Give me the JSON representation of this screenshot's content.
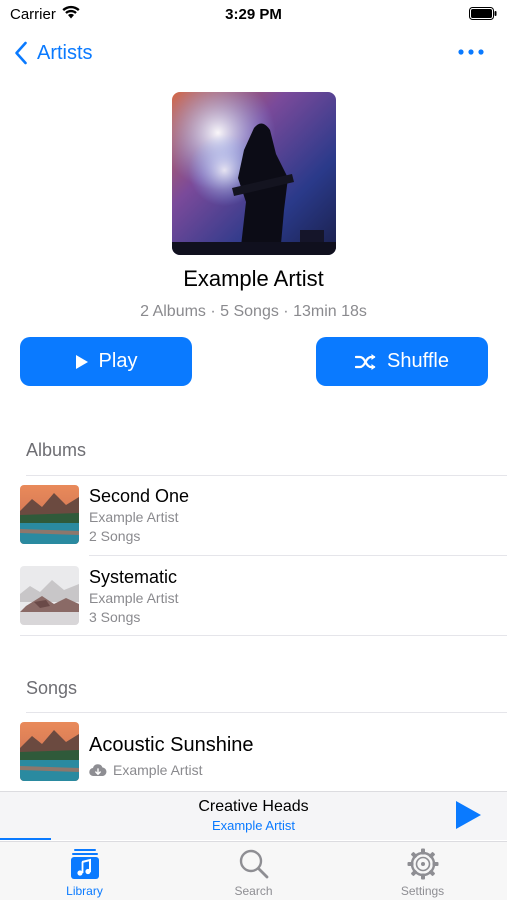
{
  "status_bar": {
    "carrier": "Carrier",
    "time": "3:29 PM"
  },
  "nav": {
    "back_label": "Artists"
  },
  "artist": {
    "name": "Example Artist",
    "meta": "2 Albums · 5 Songs · 13min 18s"
  },
  "actions": {
    "play_label": "Play",
    "shuffle_label": "Shuffle"
  },
  "albums": {
    "section_title": "Albums",
    "items": [
      {
        "title": "Second One",
        "artist": "Example Artist",
        "songs": "2 Songs"
      },
      {
        "title": "Systematic",
        "artist": "Example Artist",
        "songs": "3 Songs"
      }
    ]
  },
  "songs": {
    "section_title": "Songs",
    "items": [
      {
        "title": "Acoustic Sunshine",
        "artist": "Example Artist"
      }
    ]
  },
  "now_playing": {
    "title": "Creative Heads",
    "artist": "Example Artist",
    "progress": 0.1
  },
  "tabs": [
    {
      "label": "Library",
      "icon": "music-library-icon",
      "active": true
    },
    {
      "label": "Search",
      "icon": "search-icon",
      "active": false
    },
    {
      "label": "Settings",
      "icon": "gear-icon",
      "active": false
    }
  ],
  "colors": {
    "accent": "#0a7aff",
    "secondary_text": "#8a8a8e",
    "section_header": "#6e6e73"
  }
}
